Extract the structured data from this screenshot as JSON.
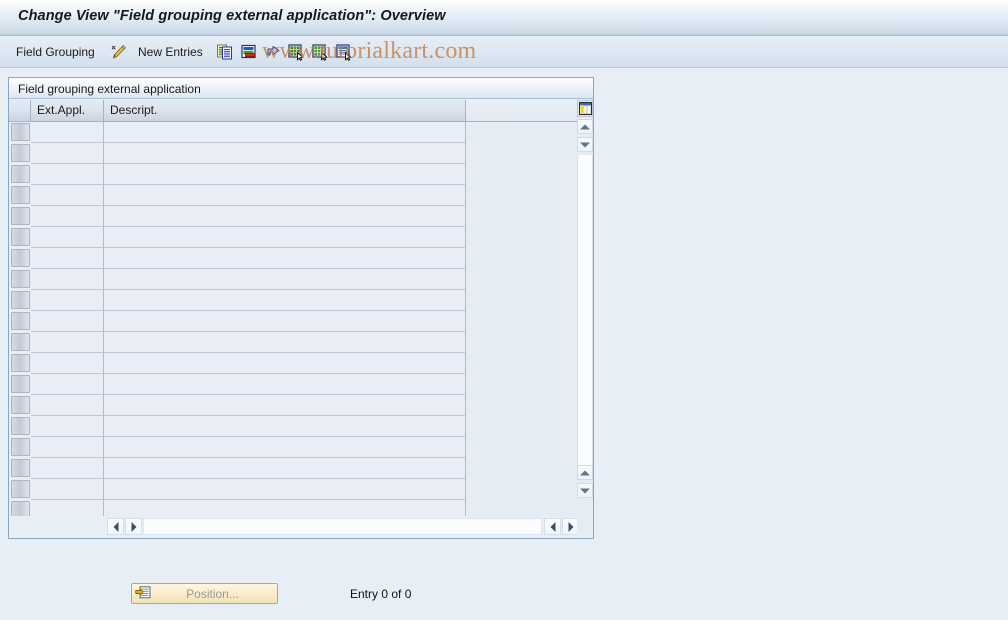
{
  "window": {
    "title": "Change View \"Field grouping external application\": Overview"
  },
  "toolbar": {
    "menu_label": "Field Grouping",
    "pencil_icon": "pencil-icon",
    "new_entries_label": "New Entries",
    "icons": [
      {
        "name": "copy-icon",
        "title": "Copy As..."
      },
      {
        "name": "delete-icon",
        "title": "Delete"
      },
      {
        "name": "undo-icon",
        "title": "Undo Change"
      },
      {
        "name": "select-all-icon",
        "title": "Select All"
      },
      {
        "name": "deselect-all-icon",
        "title": "Deselect All"
      },
      {
        "name": "select-block-icon",
        "title": "Select Block"
      }
    ]
  },
  "watermark": {
    "text": "www.tutorialkart.com",
    "color": "#c47a40"
  },
  "panel": {
    "header": "Field grouping external application",
    "config_icon": "table-settings-icon"
  },
  "table": {
    "columns": [
      {
        "key": "select",
        "label": ""
      },
      {
        "key": "ext_appl",
        "label": "Ext.Appl."
      },
      {
        "key": "descript",
        "label": "Descript."
      }
    ],
    "rows": [],
    "empty_row_count": 19
  },
  "scrollbars": {
    "vertical": {
      "up_icon": "triangle-up-icon",
      "down_icon": "triangle-down-icon",
      "bottom_up_icon": "triangle-up-icon",
      "bottom_down_icon": "triangle-down-icon"
    },
    "horizontal": {
      "left_icon": "triangle-left-icon",
      "right_icon": "triangle-right-icon",
      "far_left_icon": "triangle-left-icon",
      "far_right_icon": "triangle-right-icon"
    }
  },
  "footer": {
    "position_button_label": "Position...",
    "position_button_icon": "position-icon",
    "entry_status": "Entry 0 of 0"
  },
  "theme": {
    "page_background": "#e8eef5",
    "title_accent": "#cfdcea",
    "grid_cell": "#e9eef6",
    "border": "#8aa7c2"
  }
}
